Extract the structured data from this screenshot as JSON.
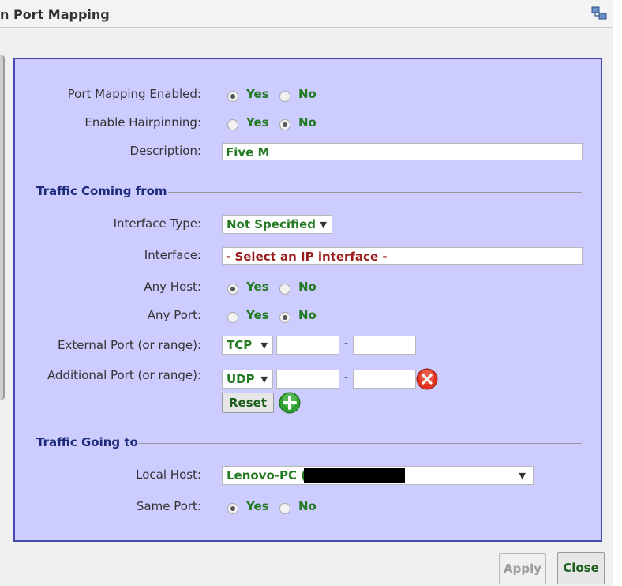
{
  "window": {
    "title": "n Port Mapping",
    "icon": "network-icon"
  },
  "form": {
    "port_mapping_enabled": {
      "label": "Port Mapping Enabled:",
      "yes": "Yes",
      "no": "No",
      "value": "Yes"
    },
    "enable_hairpinning": {
      "label": "Enable Hairpinning:",
      "yes": "Yes",
      "no": "No",
      "value": "No"
    },
    "description": {
      "label": "Description:",
      "value": "Five M"
    }
  },
  "traffic_from": {
    "heading": "Traffic Coming from",
    "interface_type": {
      "label": "Interface Type:",
      "value": "Not Specified"
    },
    "interface": {
      "label": "Interface:",
      "value": "- Select an IP interface -"
    },
    "any_host": {
      "label": "Any Host:",
      "yes": "Yes",
      "no": "No",
      "value": "Yes"
    },
    "any_port": {
      "label": "Any Port:",
      "yes": "Yes",
      "no": "No",
      "value": "No"
    },
    "external_port": {
      "label": "External Port (or range):",
      "protocol": "TCP",
      "start": "",
      "separator": "-",
      "end": ""
    },
    "additional_port": {
      "label": "Additional Port (or range):",
      "protocol": "UDP",
      "start": "",
      "separator": "-",
      "end": ""
    },
    "reset_label": "Reset"
  },
  "traffic_to": {
    "heading": "Traffic Going to",
    "local_host": {
      "label": "Local Host:",
      "value": "Lenovo-PC ("
    },
    "same_port": {
      "label": "Same Port:",
      "yes": "Yes",
      "no": "No",
      "value": "Yes"
    }
  },
  "footer": {
    "apply_label": "Apply",
    "close_label": "Close"
  },
  "colors": {
    "panel_bg": "#ccccff",
    "panel_border": "#4a49b4",
    "option_green": "#237a23",
    "heading_blue": "#1d2a79",
    "error_red": "#9b1c1c"
  }
}
